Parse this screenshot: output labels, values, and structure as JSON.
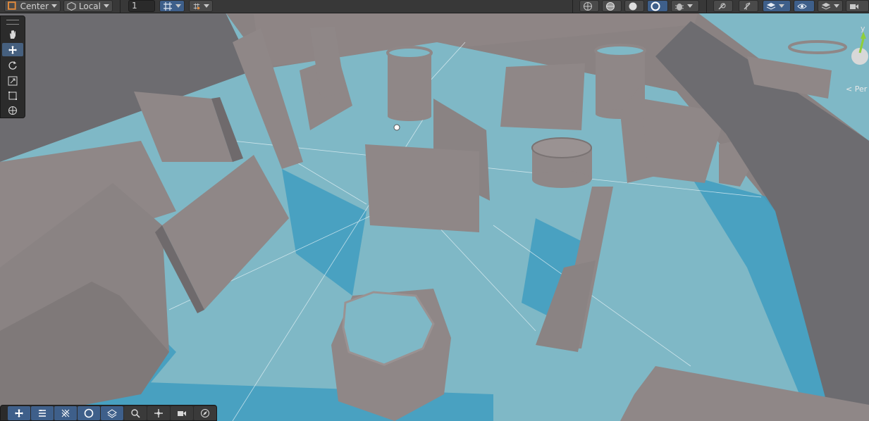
{
  "toolbar": {
    "pivot_label": "Center",
    "space_label": "Local",
    "snap_value": "1",
    "colors": {
      "active": "#3e5f8a",
      "bar": "#383838"
    }
  },
  "tool_palette": {
    "tools": [
      {
        "name": "hand-tool",
        "icon": "hand-icon",
        "active": false
      },
      {
        "name": "move-tool",
        "icon": "move-icon",
        "active": true
      },
      {
        "name": "rotate-tool",
        "icon": "rotate-icon",
        "active": false
      },
      {
        "name": "scale-tool",
        "icon": "scale-icon",
        "active": false
      },
      {
        "name": "rect-tool",
        "icon": "rect-icon",
        "active": false
      },
      {
        "name": "transform-tool",
        "icon": "transform-icon",
        "active": false
      }
    ]
  },
  "gizmo": {
    "axis_label": "y",
    "projection_label": "< Per"
  },
  "overlay_bar": {
    "buttons": [
      "move-icon",
      "components-icon",
      "navmesh-icon",
      "shading-icon",
      "layers-icon",
      "search-icon",
      "center-icon",
      "camera-icon",
      "compass-icon"
    ]
  },
  "scene_colors": {
    "floor": "#7fb8c6",
    "shadow": "#3f9cc0",
    "wall": "#8f8787",
    "wall_dark": "#6f6a6c"
  }
}
